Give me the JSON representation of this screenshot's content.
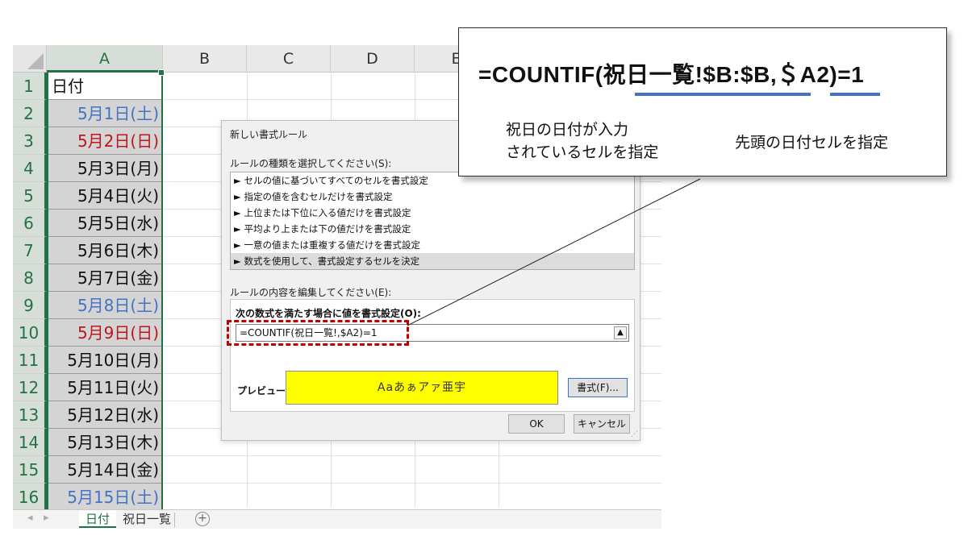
{
  "spreadsheet": {
    "columns": [
      "A",
      "B",
      "C",
      "D",
      "E"
    ],
    "rows": [
      {
        "num": "1",
        "a": "日付",
        "kind": "header"
      },
      {
        "num": "2",
        "a": "5月1日(土)",
        "kind": "sat"
      },
      {
        "num": "3",
        "a": "5月2日(日)",
        "kind": "sun"
      },
      {
        "num": "4",
        "a": "5月3日(月)",
        "kind": "normal"
      },
      {
        "num": "5",
        "a": "5月4日(火)",
        "kind": "normal"
      },
      {
        "num": "6",
        "a": "5月5日(水)",
        "kind": "normal"
      },
      {
        "num": "7",
        "a": "5月6日(木)",
        "kind": "normal"
      },
      {
        "num": "8",
        "a": "5月7日(金)",
        "kind": "normal"
      },
      {
        "num": "9",
        "a": "5月8日(土)",
        "kind": "sat"
      },
      {
        "num": "10",
        "a": "5月9日(日)",
        "kind": "sun"
      },
      {
        "num": "11",
        "a": "5月10日(月)",
        "kind": "normal"
      },
      {
        "num": "12",
        "a": "5月11日(火)",
        "kind": "normal"
      },
      {
        "num": "13",
        "a": "5月12日(水)",
        "kind": "normal"
      },
      {
        "num": "14",
        "a": "5月13日(木)",
        "kind": "normal"
      },
      {
        "num": "15",
        "a": "5月14日(金)",
        "kind": "normal"
      },
      {
        "num": "16",
        "a": "5月15日(土)",
        "kind": "sat"
      }
    ],
    "sheet_tabs": {
      "active": "日付",
      "other": "祝日一覧",
      "add": "+"
    },
    "colors": {
      "saturday": "#4472c4",
      "sunday": "#c0151b",
      "selection": "#217346"
    }
  },
  "dialog": {
    "title": "新しい書式ルール",
    "type_label": "ルールの種類を選択してください(S):",
    "rule_types": [
      "► セルの値に基づいてすべてのセルを書式設定",
      "► 指定の値を含むセルだけを書式設定",
      "► 上位または下位に入る値だけを書式設定",
      "► 平均より上または下の値だけを書式設定",
      "► 一意の値または重複する値だけを書式設定",
      "► 数式を使用して、書式設定するセルを決定"
    ],
    "selected_rule_index": 5,
    "edit_label": "ルールの内容を編集してください(E):",
    "formula_label": "次の数式を満たす場合に値を書式設定(O):",
    "formula_value": "=COUNTIF(祝日一覧!,$A2)=1",
    "collapse_icon": "▲",
    "preview_label": "プレビュー:",
    "preview_text": "Aaあぁアァ亜宇",
    "preview_color": "#ffff00",
    "format_button": "書式(F)...",
    "ok_button": "OK",
    "cancel_button": "キャンセル"
  },
  "callout": {
    "formula": "=COUNTIF(祝日一覧!$B:$B,＄A2)=1",
    "note_holiday": [
      "祝日の日付が入力",
      "されているセルを指定"
    ],
    "note_first": "先頭の日付セルを指定",
    "underline_color": "#4472c4",
    "dash_color": "#c00000"
  }
}
